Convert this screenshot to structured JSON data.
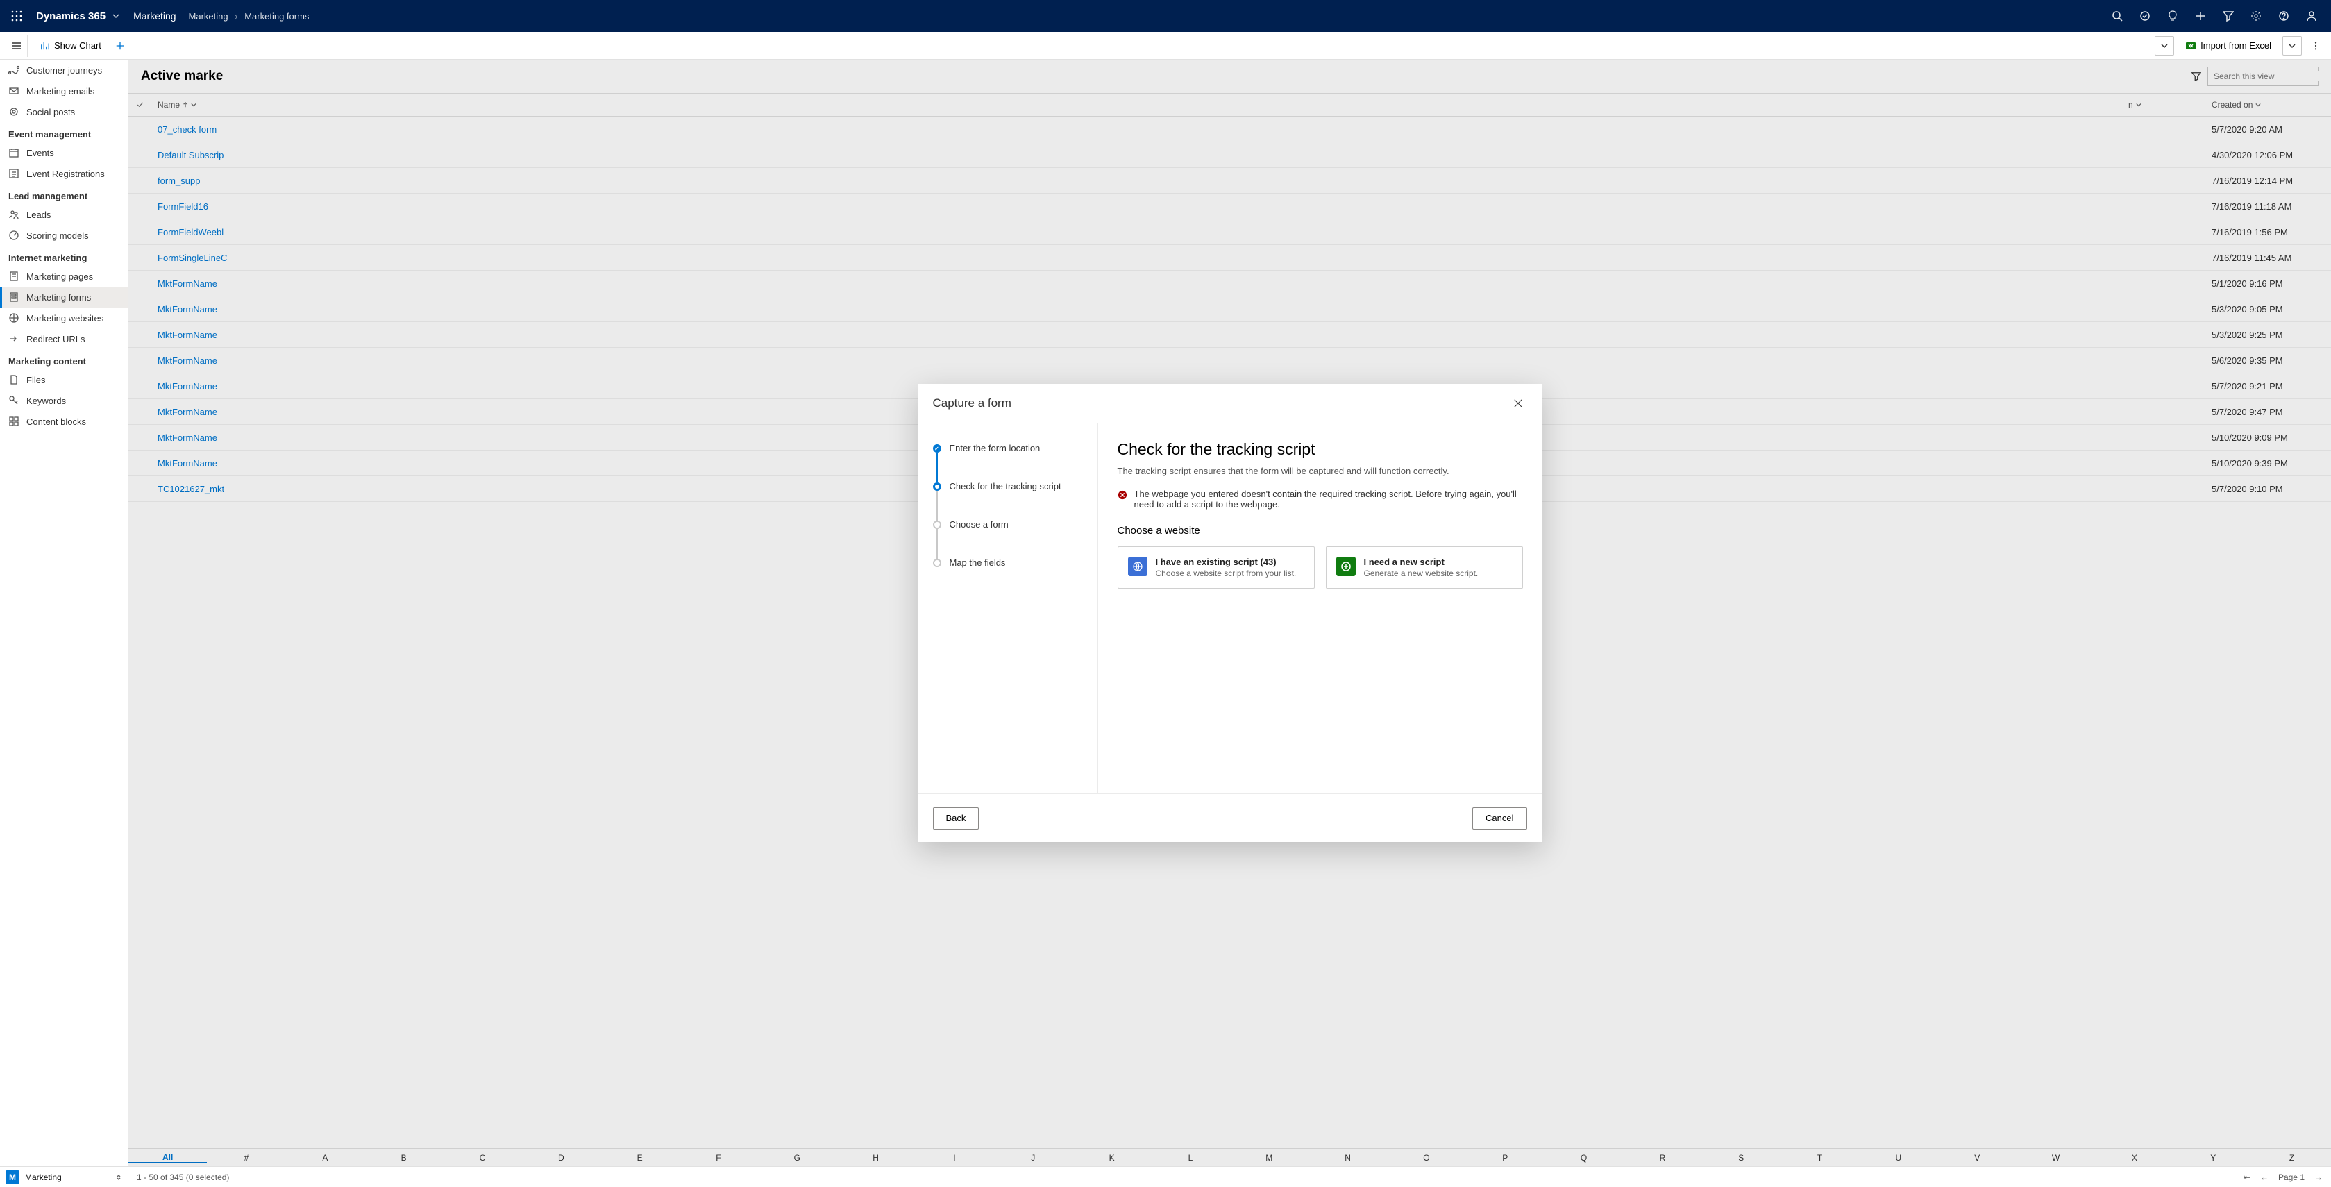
{
  "topbar": {
    "brand": "Dynamics 365",
    "area": "Marketing",
    "crumb1": "Marketing",
    "crumb2": "Marketing forms"
  },
  "cmdbar": {
    "show_chart": "Show Chart",
    "import": "Import from Excel"
  },
  "sidebar": {
    "groups": [
      {
        "items": [
          {
            "icon": "journey",
            "label": "Customer journeys"
          },
          {
            "icon": "mail",
            "label": "Marketing emails"
          },
          {
            "icon": "social",
            "label": "Social posts"
          }
        ]
      },
      {
        "label": "Event management",
        "items": [
          {
            "icon": "calendar",
            "label": "Events"
          },
          {
            "icon": "reg",
            "label": "Event Registrations"
          }
        ]
      },
      {
        "label": "Lead management",
        "items": [
          {
            "icon": "lead",
            "label": "Leads"
          },
          {
            "icon": "score",
            "label": "Scoring models"
          }
        ]
      },
      {
        "label": "Internet marketing",
        "items": [
          {
            "icon": "page",
            "label": "Marketing pages"
          },
          {
            "icon": "form",
            "label": "Marketing forms",
            "active": true
          },
          {
            "icon": "site",
            "label": "Marketing websites"
          },
          {
            "icon": "redirect",
            "label": "Redirect URLs"
          }
        ]
      },
      {
        "label": "Marketing content",
        "items": [
          {
            "icon": "file",
            "label": "Files"
          },
          {
            "icon": "key",
            "label": "Keywords"
          },
          {
            "icon": "block",
            "label": "Content blocks"
          }
        ]
      }
    ]
  },
  "view": {
    "title": "Active marke",
    "search_placeholder": "Search this view",
    "col_name": "Name",
    "col_created": "Created on"
  },
  "rows": [
    {
      "name": "07_check form",
      "created": "5/7/2020 9:20 AM"
    },
    {
      "name": "Default Subscrip",
      "created": "4/30/2020 12:06 PM"
    },
    {
      "name": "form_supp",
      "created": "7/16/2019 12:14 PM"
    },
    {
      "name": "FormField16",
      "created": "7/16/2019 11:18 AM"
    },
    {
      "name": "FormFieldWeebl",
      "created": "7/16/2019 1:56 PM"
    },
    {
      "name": "FormSingleLineC",
      "created": "7/16/2019 11:45 AM"
    },
    {
      "name": "MktFormName",
      "created": "5/1/2020 9:16 PM"
    },
    {
      "name": "MktFormName",
      "created": "5/3/2020 9:05 PM"
    },
    {
      "name": "MktFormName",
      "created": "5/3/2020 9:25 PM"
    },
    {
      "name": "MktFormName",
      "created": "5/6/2020 9:35 PM"
    },
    {
      "name": "MktFormName",
      "created": "5/7/2020 9:21 PM"
    },
    {
      "name": "MktFormName",
      "created": "5/7/2020 9:47 PM"
    },
    {
      "name": "MktFormName",
      "created": "5/10/2020 9:09 PM"
    },
    {
      "name": "MktFormName",
      "created": "5/10/2020 9:39 PM"
    },
    {
      "name": "TC1021627_mkt",
      "created": "5/7/2020 9:10 PM"
    }
  ],
  "alpha": [
    "All",
    "#",
    "A",
    "B",
    "C",
    "D",
    "E",
    "F",
    "G",
    "H",
    "I",
    "J",
    "K",
    "L",
    "M",
    "N",
    "O",
    "P",
    "Q",
    "R",
    "S",
    "T",
    "U",
    "V",
    "W",
    "X",
    "Y",
    "Z"
  ],
  "footer": {
    "area_badge": "M",
    "area_label": "Marketing",
    "status": "1 - 50 of 345 (0 selected)",
    "page": "Page 1"
  },
  "modal": {
    "title": "Capture a form",
    "steps": [
      {
        "label": "Enter the form location",
        "state": "done"
      },
      {
        "label": "Check for the tracking script",
        "state": "current"
      },
      {
        "label": "Choose a form",
        "state": "pending"
      },
      {
        "label": "Map the fields",
        "state": "pending"
      }
    ],
    "heading": "Check for the tracking script",
    "sub": "The tracking script ensures that the form will be captured and will function correctly.",
    "error": "The webpage you entered doesn't contain the required tracking script. Before trying again, you'll need to add a script to the webpage.",
    "choose_label": "Choose a website",
    "card1_title": "I have an existing script (43)",
    "card1_sub": "Choose a website script from your list.",
    "card2_title": "I need a new script",
    "card2_sub": "Generate a new website script.",
    "back": "Back",
    "cancel": "Cancel"
  }
}
